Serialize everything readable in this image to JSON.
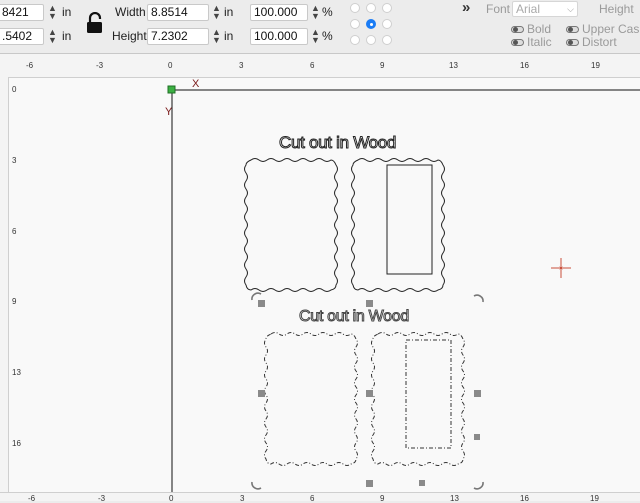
{
  "toolbar": {
    "x_value": "8421",
    "y_value": ".5402",
    "unit": "in",
    "width_label": "Width",
    "width_value": "8.8514",
    "height_label": "Height",
    "height_value": "7.2302",
    "width_pct": "100.000",
    "height_pct": "100.000",
    "pct_unit": "%",
    "overflow_chevron": "»",
    "font_label": "Font",
    "font_value": "Arial",
    "height_text_label": "Height",
    "bold_label": "Bold",
    "italic_label": "Italic",
    "upper_case_label": "Upper Cas",
    "distort_label": "Distort"
  },
  "rulers": {
    "top_ticks": [
      "-6",
      "-3",
      "0",
      "3",
      "6",
      "9",
      "13",
      "16",
      "19"
    ],
    "left_ticks": [
      "0",
      "3",
      "6",
      "9",
      "13",
      "16"
    ],
    "bottom_ticks": [
      "-6",
      "-3",
      "0",
      "3",
      "6",
      "9",
      "13",
      "16",
      "19"
    ]
  },
  "canvas": {
    "x_axis_label": "X",
    "y_axis_label": "Y",
    "top_text": "Cut out in Wood",
    "bottom_text": "Cut out in Wood"
  }
}
